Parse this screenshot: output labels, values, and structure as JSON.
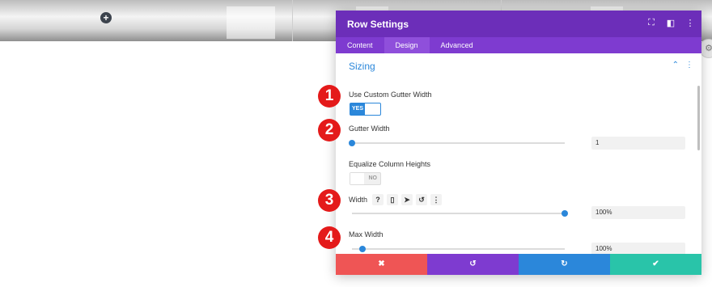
{
  "modal": {
    "title": "Row Settings",
    "tabs": [
      "Content",
      "Design",
      "Advanced"
    ],
    "active_tab": "Design",
    "section": "Sizing"
  },
  "fields": {
    "gutter_custom_label": "Use Custom Gutter Width",
    "gutter_toggle": "YES",
    "gutter_width_label": "Gutter Width",
    "gutter_width_value": "1",
    "equalize_label": "Equalize Column Heights",
    "equalize_toggle": "NO",
    "width_label": "Width",
    "width_value": "100%",
    "max_width_label": "Max Width",
    "max_width_value": "100%"
  },
  "sliders": {
    "gutter_width": 0.0,
    "width": 1.0,
    "max_width": 0.05
  },
  "markers": [
    "1",
    "2",
    "3",
    "4"
  ],
  "icons": {
    "width_help": "?",
    "width_mobile": "▯",
    "width_cursor": "➤",
    "width_reset": "↺",
    "width_more": "⋮",
    "discard": "✖",
    "undo": "↺",
    "redo": "↻",
    "save": "✔"
  },
  "colors": {
    "header": "#6c2eb9",
    "tabs": "#7e3bd0",
    "accent": "#2b87da",
    "discard": "#ef5555",
    "save": "#29c4a9",
    "marker": "#e41a1a"
  }
}
